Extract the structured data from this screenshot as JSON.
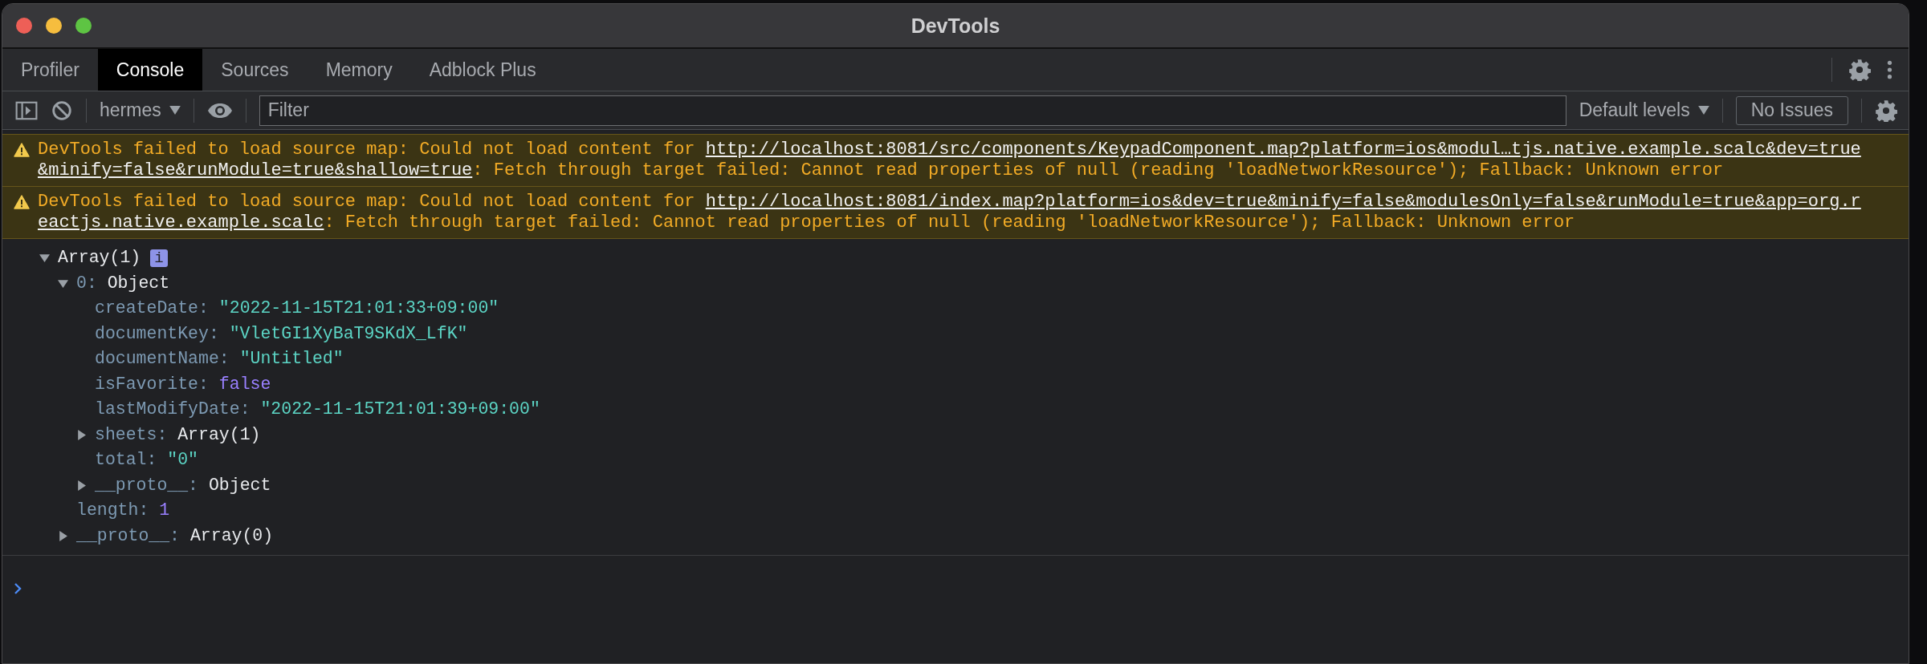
{
  "window": {
    "title": "DevTools"
  },
  "tabs": [
    {
      "label": "Profiler",
      "selected": false
    },
    {
      "label": "Console",
      "selected": true
    },
    {
      "label": "Sources",
      "selected": false
    },
    {
      "label": "Memory",
      "selected": false
    },
    {
      "label": "Adblock Plus",
      "selected": false
    }
  ],
  "toolbar": {
    "context": "hermes",
    "filter": {
      "placeholder": "Filter"
    },
    "levels": "Default levels",
    "issues": "No Issues"
  },
  "messages": [
    {
      "kind": "warning",
      "parts": [
        {
          "kind": "text",
          "text": "DevTools failed to load source map: Could not load content for "
        },
        {
          "kind": "link",
          "text": "http://localhost:8081/src/components/KeypadComponent.map?platform=ios&modul…tjs.native.example.scalc&dev=true"
        },
        {
          "kind": "link",
          "text": "&minify=false&runModule=true&shallow=true"
        },
        {
          "kind": "text",
          "text": ": Fetch through target failed: Cannot read properties of null (reading 'loadNetworkResource'); Fallback: Unknown error"
        }
      ]
    },
    {
      "kind": "warning",
      "parts": [
        {
          "kind": "text",
          "text": "DevTools failed to load source map: Could not load content for "
        },
        {
          "kind": "link",
          "text": "http://localhost:8081/index.map?platform=ios&dev=true&minify=false&modulesOnly=false&runModule=true&app=org.r"
        },
        {
          "kind": "link",
          "text": "eactjs.native.example.scalc"
        },
        {
          "kind": "text",
          "text": ": Fetch through target failed: Cannot read properties of null (reading 'loadNetworkResource'); Fallback: Unknown error"
        }
      ]
    }
  ],
  "tree": {
    "value": "Array(1)",
    "kind": "object",
    "badge": "i",
    "expanded": true,
    "children": [
      {
        "key": "0:",
        "value": "Object",
        "kind": "object",
        "expanded": true,
        "children": [
          {
            "key": "createDate:",
            "value": "\"2022-11-15T21:01:33+09:00\"",
            "kind": "string"
          },
          {
            "key": "documentKey:",
            "value": "\"VletGI1XyBaT9SKdX_LfK\"",
            "kind": "string"
          },
          {
            "key": "documentName:",
            "value": "\"Untitled\"",
            "kind": "string"
          },
          {
            "key": "isFavorite:",
            "value": "false",
            "kind": "boolean"
          },
          {
            "key": "lastModifyDate:",
            "value": "\"2022-11-15T21:01:39+09:00\"",
            "kind": "string"
          },
          {
            "key": "sheets:",
            "value": "Array(1)",
            "kind": "object",
            "expanded": false
          },
          {
            "key": "total:",
            "value": "\"0\"",
            "kind": "string"
          },
          {
            "key": "__proto__:",
            "value": "Object",
            "kind": "object",
            "expanded": false
          }
        ]
      },
      {
        "key": "length:",
        "value": "1",
        "kind": "number"
      },
      {
        "key": "__proto__:",
        "value": "Array(0)",
        "kind": "object",
        "expanded": false
      }
    ]
  }
}
